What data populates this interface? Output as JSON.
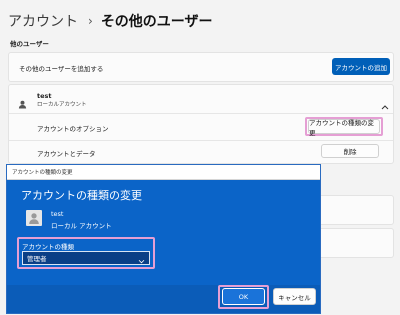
{
  "breadcrumb": {
    "parent": "アカウント",
    "separator": "›",
    "current": "その他のユーザー"
  },
  "section_title": "他のユーザー",
  "add_user": {
    "label": "その他のユーザーを追加する",
    "button": "アカウントの追加"
  },
  "user": {
    "name": "test",
    "type": "ローカルアカウント"
  },
  "account_options": {
    "label": "アカウントのオプション",
    "button": "アカウントの種類の変更"
  },
  "account_data": {
    "label": "アカウントとデータ",
    "button": "削除"
  },
  "dialog": {
    "title": "アカウントの種類の変更",
    "heading": "アカウントの種類の変更",
    "user_name": "test",
    "user_type": "ローカル アカウント",
    "field_label": "アカウントの種類",
    "selected_value": "管理者",
    "ok": "OK",
    "cancel": "キャンセル"
  },
  "colors": {
    "accent": "#005fb8",
    "dialog_bg": "#0b64c8",
    "highlight": "#e59fd4"
  },
  "icons": [
    "person-icon",
    "chevron-up-icon",
    "chevron-down-icon"
  ]
}
